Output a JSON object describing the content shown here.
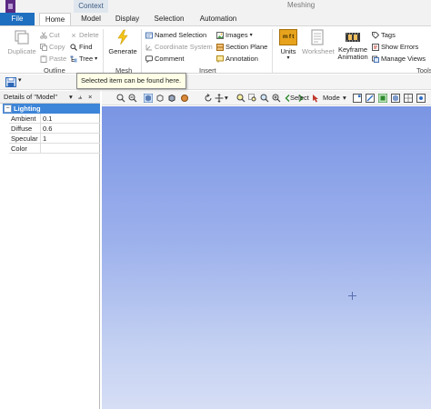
{
  "window": {
    "title": "Meshing",
    "context_tab": "Context"
  },
  "tabs": [
    {
      "label": "File"
    },
    {
      "label": "Home"
    },
    {
      "label": "Model"
    },
    {
      "label": "Display"
    },
    {
      "label": "Selection"
    },
    {
      "label": "Automation"
    }
  ],
  "ribbon": {
    "outline": {
      "label": "Outline",
      "duplicate": "Duplicate",
      "cut": "Cut",
      "copy": "Copy",
      "paste": "Paste",
      "delete": "Delete",
      "find": "Find",
      "tree": "Tree"
    },
    "mesh": {
      "label": "Mesh",
      "generate": "Generate"
    },
    "insert": {
      "label": "Insert",
      "named_selection": "Named Selection",
      "coordinate_system": "Coordinate System",
      "comment": "Comment",
      "images": "Images",
      "section_plane": "Section Plane",
      "annotation": "Annotation"
    },
    "units": {
      "label": "Units",
      "units_icon_text": "m f t"
    },
    "worksheet": "Worksheet",
    "keyframe": {
      "line1": "Keyframe",
      "line2": "Animation"
    },
    "tools": {
      "label": "Tools",
      "tags": "Tags",
      "show_errors": "Show Errors",
      "manage_views": "Manage Views"
    }
  },
  "tooltip": {
    "text": "Selected item can be found here."
  },
  "graphics_toolbar": {
    "select": "Select",
    "mode": "Mode"
  },
  "details": {
    "title": "Details of \"Model\"",
    "pin": "⫨",
    "close": "×",
    "section": {
      "label": "Lighting",
      "toggle": "−"
    },
    "rows": [
      {
        "name": "Ambient",
        "value": "0.1"
      },
      {
        "name": "Diffuse",
        "value": "0.6"
      },
      {
        "name": "Specular",
        "value": "1"
      },
      {
        "name": "Color",
        "value": ""
      }
    ]
  },
  "colors": {
    "file_tab": "#1f6fc0",
    "section_header": "#3d85d8",
    "viewport_top": "#7a95e4",
    "viewport_bottom": "#d6def5"
  }
}
